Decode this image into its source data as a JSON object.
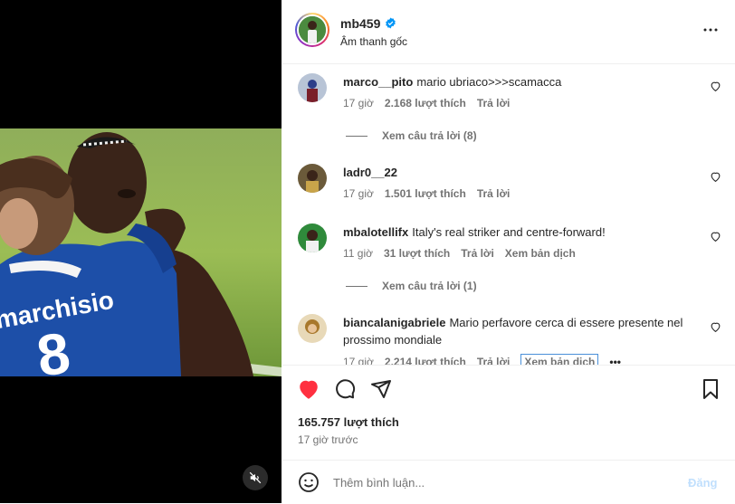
{
  "post": {
    "username": "mb459",
    "audio": "Âm thanh gốc",
    "likes": "165.757 lượt thích",
    "time": "17 giờ trước",
    "jersey_name": "marchisio",
    "jersey_number": "8"
  },
  "comments": [
    {
      "user": "marco__pito",
      "text": "mario ubriaco>>>scamacca",
      "time": "17 giờ",
      "likes": "2.168 lượt thích",
      "reply": "Trả lời",
      "view_replies": "Xem câu trả lời (8)"
    },
    {
      "user": "ladr0__22",
      "text": "",
      "time": "17 giờ",
      "likes": "1.501 lượt thích",
      "reply": "Trả lời"
    },
    {
      "user": "mbalotellifx",
      "text": "Italy's real striker and centre-forward!",
      "time": "11 giờ",
      "likes": "31 lượt thích",
      "reply": "Trả lời",
      "translate": "Xem bản dịch",
      "view_replies": "Xem câu trả lời (1)"
    },
    {
      "user": "biancalanigabriele",
      "text": "Mario perfavore cerca di essere presente nel prossimo mondiale",
      "time": "17 giờ",
      "likes": "2.214 lượt thích",
      "reply": "Trả lời",
      "translate": "Xem bản dịch"
    }
  ],
  "comment_input": {
    "placeholder": "Thêm bình luận...",
    "post_label": "Đăng"
  },
  "colors": {
    "like_red": "#ff3040",
    "verified_blue": "#0095f6",
    "muted_text": "#737373"
  },
  "icons": {
    "verified": "verified-badge-icon",
    "more": "more-options-icon",
    "like": "heart-filled-icon",
    "comment": "comment-icon",
    "share": "share-icon",
    "save": "bookmark-icon",
    "emoji": "emoji-icon",
    "mute": "speaker-muted-icon"
  }
}
